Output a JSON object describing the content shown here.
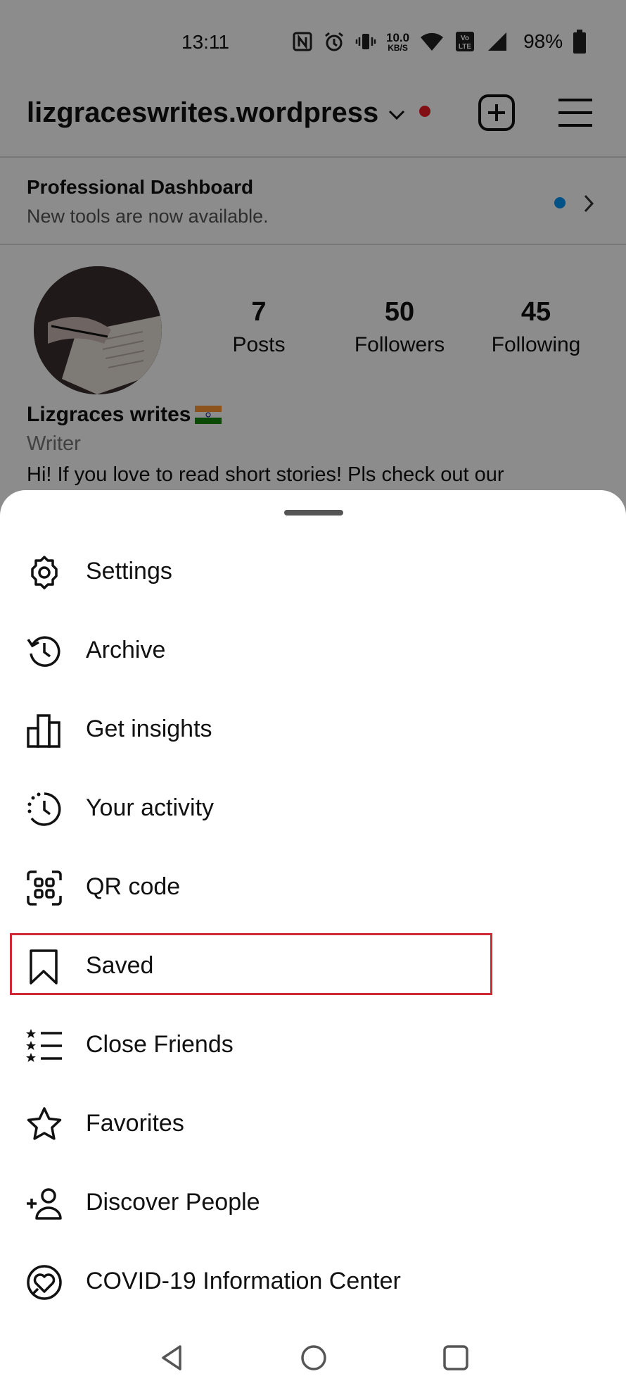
{
  "status_bar": {
    "time": "13:11",
    "network_speed_value": "10.0",
    "network_speed_unit": "KB/S",
    "battery": "98%",
    "icons": [
      "nfc-icon",
      "alarm-icon",
      "vibrate-icon",
      "wifi-icon",
      "volte-icon",
      "cell-signal-icon",
      "battery-icon"
    ]
  },
  "header": {
    "username": "lizgraceswrites.wordpress",
    "icons": [
      "chevron-down-icon",
      "new-post-icon",
      "hamburger-menu-icon"
    ]
  },
  "pro_dashboard": {
    "title": "Professional Dashboard",
    "subtitle": "New tools are now available."
  },
  "profile": {
    "stats": [
      {
        "value": "7",
        "label": "Posts"
      },
      {
        "value": "50",
        "label": "Followers"
      },
      {
        "value": "45",
        "label": "Following"
      }
    ],
    "name": "Lizgraces writes",
    "category": "Writer",
    "bio": "Hi! If you love to read short stories! Pls check out our"
  },
  "menu": {
    "items": [
      {
        "label": "Settings",
        "icon": "settings-gear-icon"
      },
      {
        "label": "Archive",
        "icon": "archive-history-icon"
      },
      {
        "label": "Get insights",
        "icon": "insights-bar-chart-icon"
      },
      {
        "label": "Your activity",
        "icon": "activity-clock-icon"
      },
      {
        "label": "QR code",
        "icon": "qr-code-icon"
      },
      {
        "label": "Saved",
        "icon": "bookmark-icon"
      },
      {
        "label": "Close Friends",
        "icon": "close-friends-list-icon"
      },
      {
        "label": "Favorites",
        "icon": "star-icon"
      },
      {
        "label": "Discover People",
        "icon": "add-person-icon"
      },
      {
        "label": "COVID-19 Information Center",
        "icon": "covid-heart-icon"
      }
    ],
    "highlighted": "Saved"
  },
  "nav": {
    "icons": [
      "back-triangle-icon",
      "home-circle-icon",
      "recents-square-icon"
    ]
  },
  "colors": {
    "notification_dot": "#ed1c24",
    "info_dot": "#0095f6",
    "highlight_box": "#cd2a35"
  }
}
